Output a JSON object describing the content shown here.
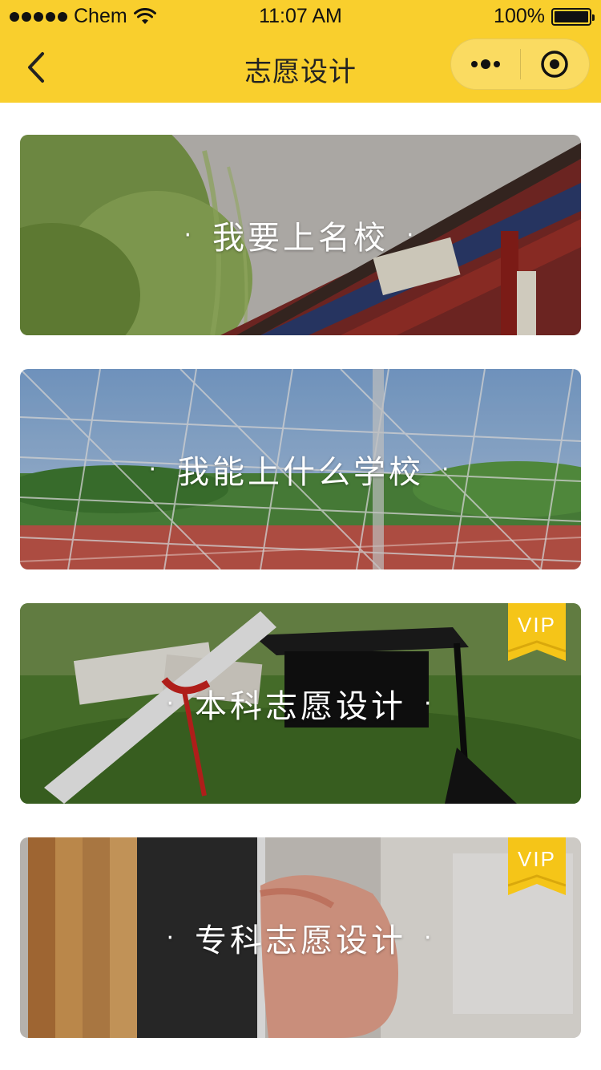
{
  "status_bar": {
    "carrier": "Chem",
    "time": "11:07 AM",
    "battery": "100%"
  },
  "nav": {
    "title": "志愿设计",
    "back_icon": "chevron-left-icon",
    "more_icon": "more-dots-icon",
    "close_icon": "target-close-icon"
  },
  "colors": {
    "accent": "#f9cf2d",
    "vip_badge": "#f5c518",
    "card_text": "#ffffff"
  },
  "cards": [
    {
      "label": "我要上名校",
      "vip": false,
      "image": "campus-gate-photo"
    },
    {
      "label": "我能上什么学校",
      "vip": false,
      "image": "sports-field-net-photo"
    },
    {
      "label": "本科志愿设计",
      "vip": true,
      "vip_label": "VIP",
      "image": "graduation-cap-diploma-photo"
    },
    {
      "label": "专科志愿设计",
      "vip": true,
      "vip_label": "VIP",
      "image": "books-hand-photo"
    }
  ]
}
